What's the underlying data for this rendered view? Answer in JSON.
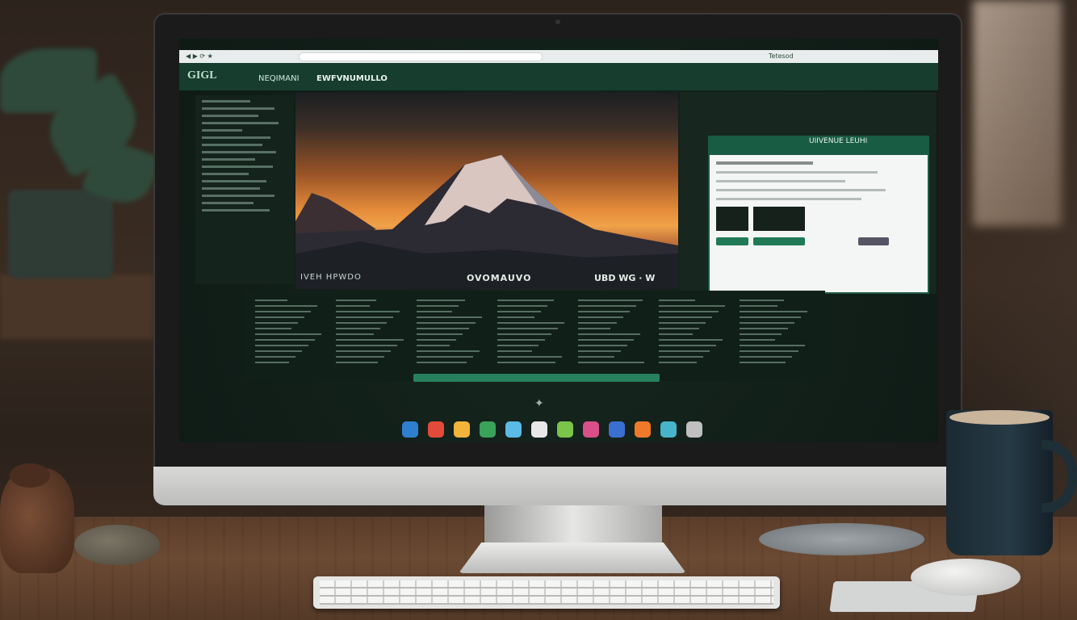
{
  "scene": "desk-with-monitor",
  "screen": {
    "toolbar": {
      "url_text": "",
      "right_label": "Tetesod"
    },
    "header": {
      "title": "GIGL",
      "subtitle": "NEQIMANI",
      "app_name": "EWFVNUMULLO"
    },
    "photo": {
      "caption_left": "IVEH HPWDO",
      "caption_center": "OVOMAUVO",
      "caption_right": "UBD WG · W"
    },
    "doc_window": {
      "title": "UIIVENUE LEUHI"
    }
  },
  "colors": {
    "screen_bg": "#13211b",
    "accent_green": "#1f7a55",
    "sunset_orange": "#e58c3a",
    "desk_wood": "#5a3d2a"
  },
  "dock_icons": [
    "finder-icon",
    "chrome-icon",
    "mail-icon",
    "files-icon",
    "app-icon",
    "photos-icon",
    "notes-icon",
    "maps-icon",
    "music-icon",
    "safari-icon",
    "store-icon",
    "settings-icon"
  ]
}
